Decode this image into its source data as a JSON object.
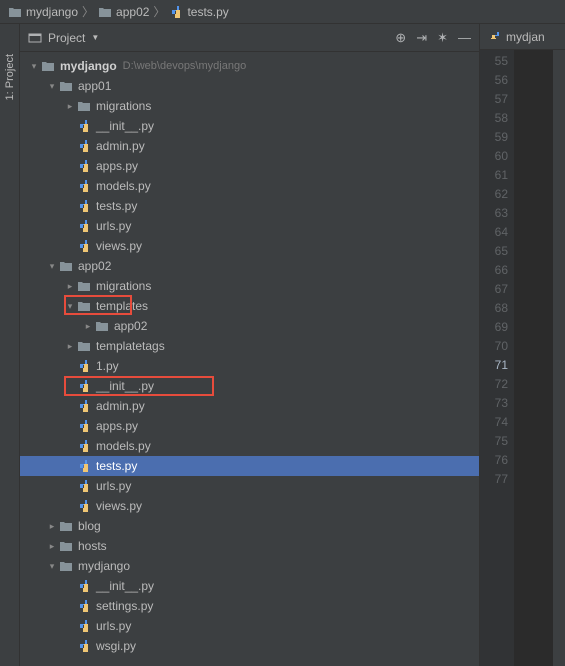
{
  "breadcrumb": [
    {
      "label": "mydjango",
      "icon": "folder"
    },
    {
      "label": "app02",
      "icon": "folder"
    },
    {
      "label": "tests.py",
      "icon": "python"
    }
  ],
  "panel": {
    "title": "Project"
  },
  "sidebar_tab": "1: Project",
  "editor_tab": {
    "label": "mydjan"
  },
  "gutter": {
    "start": 55,
    "end": 77,
    "current": 71
  },
  "tree": [
    {
      "depth": 0,
      "expand": "down",
      "icon": "folder",
      "bold": true,
      "label": "mydjango",
      "suffix": "D:\\web\\devops\\mydjango"
    },
    {
      "depth": 1,
      "expand": "down",
      "icon": "folder",
      "label": "app01"
    },
    {
      "depth": 2,
      "expand": "right",
      "icon": "folder",
      "label": "migrations"
    },
    {
      "depth": 2,
      "expand": "",
      "icon": "python",
      "label": "__init__.py"
    },
    {
      "depth": 2,
      "expand": "",
      "icon": "python",
      "label": "admin.py"
    },
    {
      "depth": 2,
      "expand": "",
      "icon": "python",
      "label": "apps.py"
    },
    {
      "depth": 2,
      "expand": "",
      "icon": "python",
      "label": "models.py"
    },
    {
      "depth": 2,
      "expand": "",
      "icon": "python",
      "label": "tests.py"
    },
    {
      "depth": 2,
      "expand": "",
      "icon": "python",
      "label": "urls.py"
    },
    {
      "depth": 2,
      "expand": "",
      "icon": "python",
      "label": "views.py"
    },
    {
      "depth": 1,
      "expand": "down",
      "icon": "folder",
      "label": "app02"
    },
    {
      "depth": 2,
      "expand": "right",
      "icon": "folder",
      "label": "migrations"
    },
    {
      "depth": 2,
      "expand": "down",
      "icon": "folder",
      "label": "templates"
    },
    {
      "depth": 3,
      "expand": "right",
      "icon": "folder",
      "label": "app02"
    },
    {
      "depth": 2,
      "expand": "right",
      "icon": "folder",
      "label": "templatetags"
    },
    {
      "depth": 2,
      "expand": "",
      "icon": "python",
      "label": "1.py"
    },
    {
      "depth": 2,
      "expand": "",
      "icon": "python",
      "label": "__init__.py"
    },
    {
      "depth": 2,
      "expand": "",
      "icon": "python",
      "label": "admin.py"
    },
    {
      "depth": 2,
      "expand": "",
      "icon": "python",
      "label": "apps.py"
    },
    {
      "depth": 2,
      "expand": "",
      "icon": "python",
      "label": "models.py"
    },
    {
      "depth": 2,
      "expand": "",
      "icon": "python",
      "label": "tests.py",
      "selected": true
    },
    {
      "depth": 2,
      "expand": "",
      "icon": "python",
      "label": "urls.py"
    },
    {
      "depth": 2,
      "expand": "",
      "icon": "python",
      "label": "views.py"
    },
    {
      "depth": 1,
      "expand": "right",
      "icon": "folder",
      "label": "blog"
    },
    {
      "depth": 1,
      "expand": "right",
      "icon": "folder",
      "label": "hosts"
    },
    {
      "depth": 1,
      "expand": "down",
      "icon": "folder",
      "label": "mydjango"
    },
    {
      "depth": 2,
      "expand": "",
      "icon": "python",
      "label": "__init__.py"
    },
    {
      "depth": 2,
      "expand": "",
      "icon": "python",
      "label": "settings.py"
    },
    {
      "depth": 2,
      "expand": "",
      "icon": "python",
      "label": "urls.py"
    },
    {
      "depth": 2,
      "expand": "",
      "icon": "python",
      "label": "wsgi.py"
    }
  ]
}
